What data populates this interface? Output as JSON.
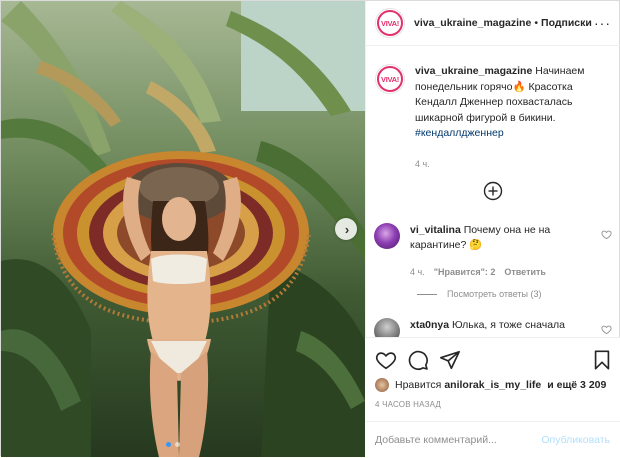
{
  "post": {
    "author": "viva_ukraine_magazine",
    "logo_text": "VIVA!",
    "separator": "•",
    "follow_label": "Подписки",
    "more_label": "···"
  },
  "caption": {
    "author": "viva_ukraine_magazine",
    "text": "Начинаем понедельник горячо🔥 Красотка Кендалл Дженнер похвасталась шикарной фигурой в бикини.",
    "hashtag": "#кендаллдженнер",
    "time": "4 ч."
  },
  "comments": [
    {
      "author": "vi_vitalina",
      "text": "Почему она не на карантине? 🤔",
      "time": "4 ч.",
      "likes": "\"Нравится\": 2",
      "reply": "Ответить",
      "view_replies": "Посмотреть ответы (3)"
    },
    {
      "author": "xta0nya",
      "text": "Юлька, я тоже сначала"
    }
  ],
  "likes": {
    "prefix": "Нравится",
    "user": "anilorak_is_my_life",
    "suffix": "и ещё 3 209"
  },
  "timestamp": "4 ЧАСОВ НАЗАД",
  "comment_input": {
    "placeholder": "Добавьте комментарий...",
    "publish_label": "Опубликовать"
  },
  "icons": {
    "like": "heart-icon",
    "comment": "comment-icon",
    "share": "share-icon",
    "save": "bookmark-icon",
    "add": "plus-circle-icon",
    "next": "chevron-right-icon"
  },
  "colors": {
    "text": "#262626",
    "secondary": "#8e8e8e",
    "link": "#00376b",
    "publish_disabled": "#b2dffc",
    "active_dot": "#3897f0"
  }
}
